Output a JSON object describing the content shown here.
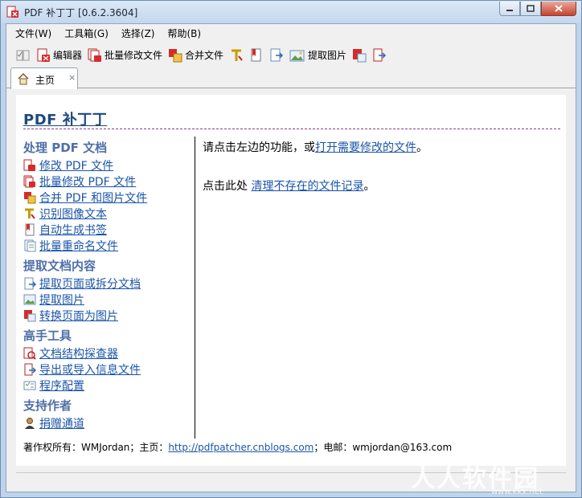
{
  "window": {
    "title": "PDF 补丁丁 [0.6.2.3604]"
  },
  "menubar": [
    "文件(W)",
    "工具箱(G)",
    "选择(Z)",
    "帮助(B)"
  ],
  "toolbar": {
    "editor": "编辑器",
    "batch_modify": "批量修改文件",
    "merge": "合并文件",
    "extract_images": "提取图片"
  },
  "tab": {
    "label": "主页",
    "close": "×"
  },
  "page": {
    "title": "PDF 补丁丁",
    "sections": [
      {
        "heading": "处理 PDF 文档",
        "items": [
          {
            "label": "修改 PDF 文件",
            "icon": "pdf-edit-icon"
          },
          {
            "label": "批量修改 PDF 文件",
            "icon": "pdf-batch-icon"
          },
          {
            "label": "合并 PDF 和图片文件",
            "icon": "merge-icon"
          },
          {
            "label": "识别图像文本",
            "icon": "ocr-icon"
          },
          {
            "label": "自动生成书签",
            "icon": "bookmark-icon"
          },
          {
            "label": "批量重命名文件",
            "icon": "rename-icon"
          }
        ]
      },
      {
        "heading": "提取文档内容",
        "items": [
          {
            "label": "提取页面或拆分文档",
            "icon": "extract-pages-icon"
          },
          {
            "label": "提取图片",
            "icon": "image-icon"
          },
          {
            "label": "转换页面为图片",
            "icon": "pdf-to-image-icon"
          }
        ]
      },
      {
        "heading": "高手工具",
        "items": [
          {
            "label": "文档结构探查器",
            "icon": "inspector-icon"
          },
          {
            "label": "导出或导入信息文件",
            "icon": "export-import-icon"
          },
          {
            "label": "程序配置",
            "icon": "settings-icon"
          }
        ]
      },
      {
        "heading": "支持作者",
        "items": [
          {
            "label": "捐赠通道",
            "icon": "donate-icon"
          }
        ]
      }
    ],
    "main": {
      "line1_prefix": "请点击左边的功能，或",
      "line1_link": "打开需要修改的文件",
      "line1_suffix": "。",
      "line2_prefix": "点击此处 ",
      "line2_link": "清理不存在的文件记录",
      "line2_suffix": "。"
    },
    "footer": {
      "prefix": "著作权所有：WMJordan；主页：",
      "link": "http://pdfpatcher.cnblogs.com",
      "suffix": "；电邮：wmjordan@163.com"
    }
  },
  "watermark": {
    "text": "人人软件园",
    "url": "www.kkx.net"
  }
}
